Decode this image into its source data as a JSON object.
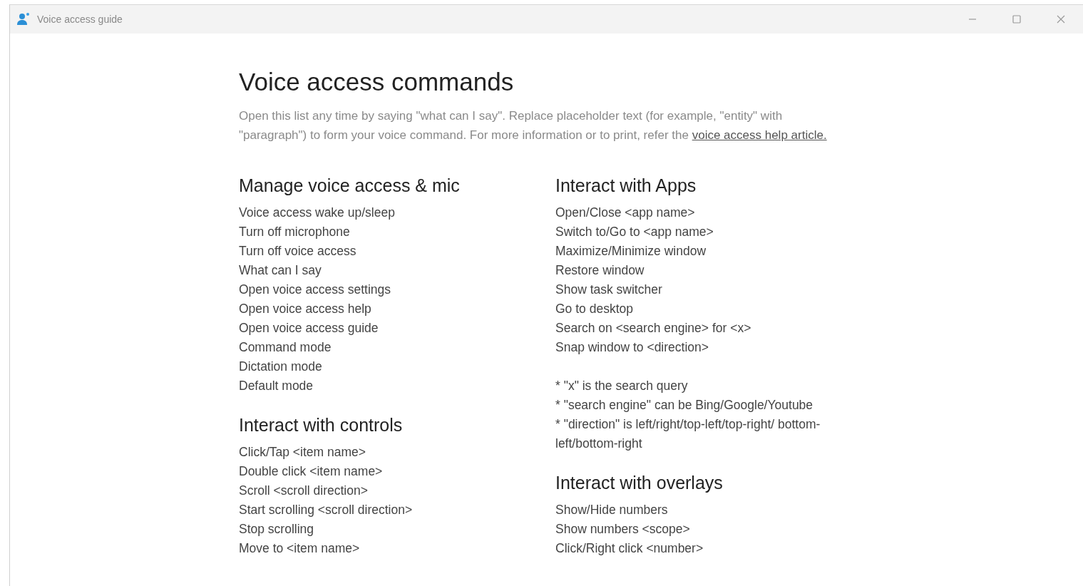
{
  "window": {
    "title": "Voice access guide"
  },
  "heading": "Voice access commands",
  "intro": {
    "text": "Open this list any time by saying \"what can I say\". Replace placeholder text (for example, \"entity\" with \"paragraph\") to form your voice command. For more information or to print, refer the",
    "link": "voice access help article."
  },
  "columns": [
    {
      "sections": [
        {
          "title": "Manage voice access & mic",
          "items": [
            "Voice access wake up/sleep",
            "Turn off microphone",
            "Turn off voice access",
            "What can I say",
            "Open voice access settings",
            "Open voice access help",
            "Open voice access guide",
            "Command mode",
            "Dictation mode",
            "Default mode"
          ]
        },
        {
          "title": "Interact with controls",
          "items": [
            "Click/Tap <item name>",
            "Double click <item name>",
            "Scroll <scroll direction>",
            "Start scrolling <scroll direction>",
            "Stop scrolling",
            "Move to <item name>"
          ]
        }
      ]
    },
    {
      "sections": [
        {
          "title": "Interact with Apps",
          "items": [
            "Open/Close <app name>",
            "Switch to/Go to <app name>",
            "Maximize/Minimize window",
            "Restore window",
            "Show task switcher",
            "Go to desktop",
            "Search on <search engine> for <x>",
            "Snap window to <direction>"
          ],
          "notes": [
            "* \"x\" is the search query",
            "* \"search engine\" can be Bing/Google/Youtube",
            "* \"direction\" is left/right/top-left/top-right/ bottom-left/bottom-right"
          ]
        },
        {
          "title": "Interact with overlays",
          "items": [
            "Show/Hide numbers",
            "Show numbers <scope>",
            "Click/Right click <number>"
          ]
        }
      ]
    }
  ]
}
